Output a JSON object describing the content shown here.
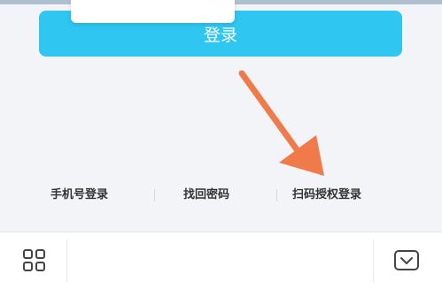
{
  "login": {
    "button_label": "登录"
  },
  "links": {
    "phone_login": "手机号登录",
    "recover_password": "找回密码",
    "scan_authorize": "扫码授权登录"
  },
  "colors": {
    "primary_button": "#2fc6f2",
    "annotation_arrow": "#f07a4a",
    "background": "#f3f4f7"
  },
  "bottom_bar": {
    "left_icon": "grid-icon",
    "right_icon": "collapse-keyboard-icon"
  }
}
